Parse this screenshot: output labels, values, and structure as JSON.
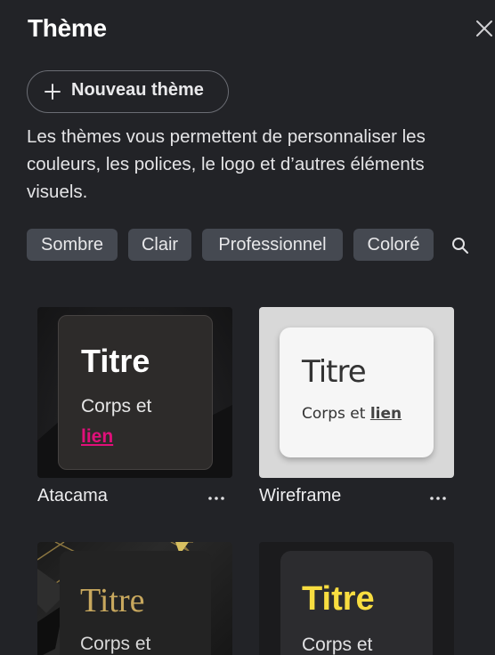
{
  "panel": {
    "title": "Thème",
    "new_theme_label": "Nouveau thème",
    "description": "Les thèmes vous permettent de personnaliser les couleurs, les polices, le logo et d’autres éléments visuels."
  },
  "filters": [
    "Sombre",
    "Clair",
    "Professionnel",
    "Coloré"
  ],
  "themes": [
    {
      "name": "Atacama",
      "preview_title": "Titre",
      "preview_body": "Corps et",
      "preview_link": "lien",
      "accent": "#e0107a"
    },
    {
      "name": "Wireframe",
      "preview_title": "Titre",
      "preview_body": "Corps et",
      "preview_link": "lien",
      "accent": "#444444"
    },
    {
      "name": "",
      "preview_title": "Titre",
      "preview_body": "Corps et",
      "accent": "#c8a85e"
    },
    {
      "name": "",
      "preview_title": "Titre",
      "preview_body": "Corps et",
      "accent": "#f8dd40"
    }
  ],
  "icons": {
    "close": "close-icon",
    "add": "plus-icon",
    "search": "search-icon",
    "more": "more-horizontal-icon"
  },
  "colors": {
    "background": "#222327",
    "chip_background": "#454951"
  }
}
